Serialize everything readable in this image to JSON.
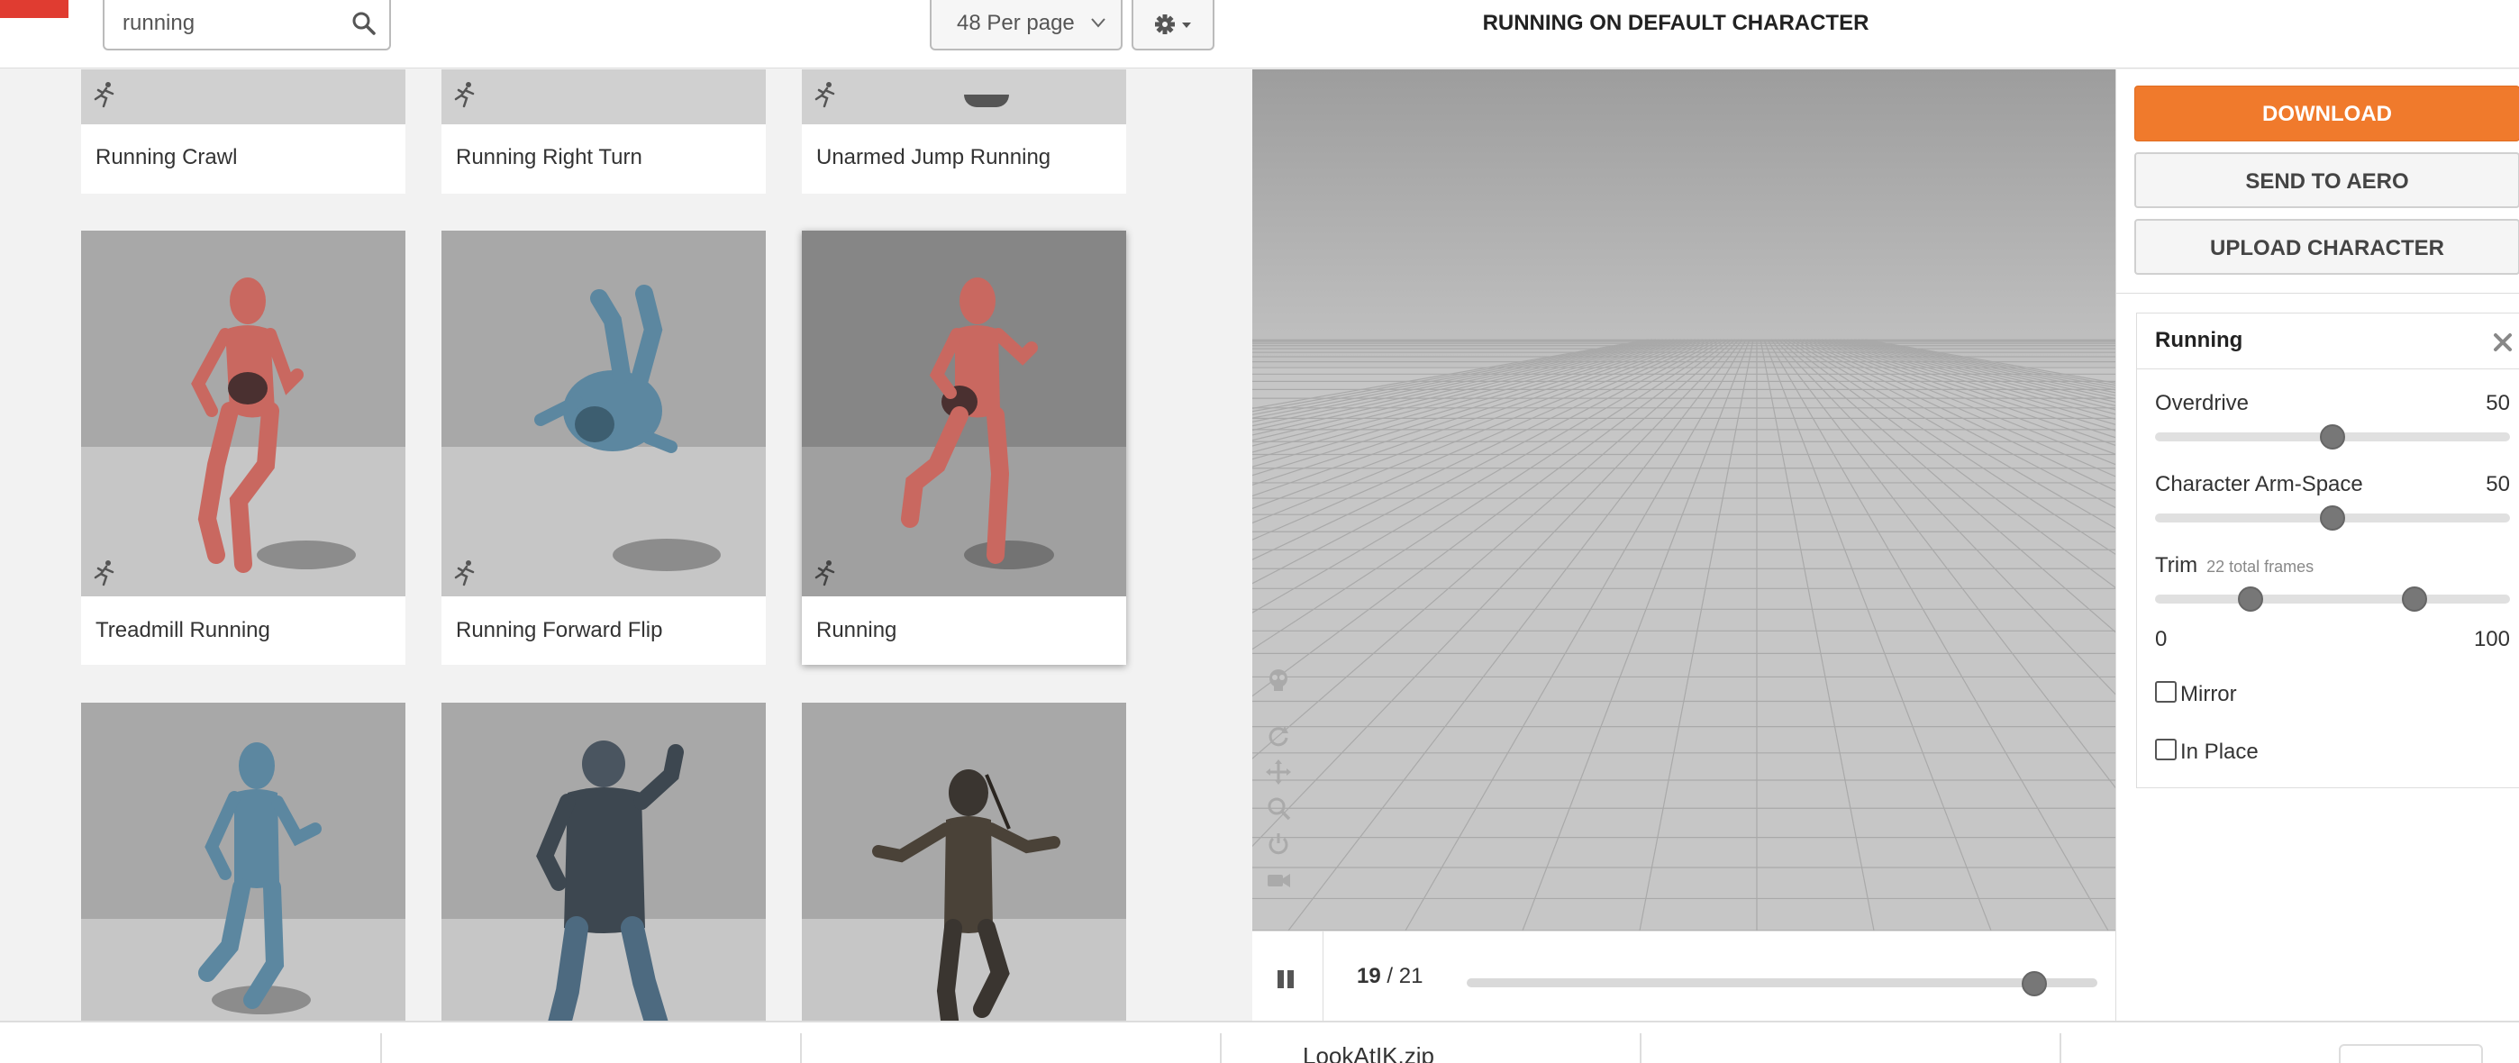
{
  "search": {
    "value": "running",
    "placeholder": "Search"
  },
  "per_page": {
    "selected": "48 Per page"
  },
  "grid": {
    "row1": [
      {
        "label": "Running Crawl"
      },
      {
        "label": "Running Right Turn"
      },
      {
        "label": "Unarmed Jump Running"
      }
    ],
    "row2": [
      {
        "label": "Treadmill Running"
      },
      {
        "label": "Running Forward Flip"
      },
      {
        "label": "Running",
        "selected": true
      }
    ],
    "row3": [
      {
        "label": ""
      },
      {
        "label": ""
      },
      {
        "label": ""
      }
    ]
  },
  "preview": {
    "title": "RUNNING ON DEFAULT CHARACTER"
  },
  "playback": {
    "current_frame": "19",
    "total_frames": "21",
    "progress_fraction": 0.9
  },
  "actions": {
    "download": "DOWNLOAD",
    "send_to_aero": "SEND TO AERO",
    "upload_character": "UPLOAD CHARACTER"
  },
  "animation_panel": {
    "title": "Running",
    "overdrive": {
      "label": "Overdrive",
      "value": "50",
      "fraction": 0.5
    },
    "arm_space": {
      "label": "Character Arm-Space",
      "value": "50",
      "fraction": 0.5
    },
    "trim": {
      "label": "Trim",
      "note": "22 total frames",
      "min": "0",
      "max": "100",
      "start_fraction": 0.27,
      "end_fraction": 0.73
    },
    "mirror": {
      "label": "Mirror",
      "checked": false
    },
    "in_place": {
      "label": "In Place",
      "checked": false
    }
  },
  "downloads_bar": {
    "file": "LookAtIK.zip"
  },
  "colors": {
    "accent": "#f07a2c",
    "brand_red": "#e03c31",
    "mannequin_red": "#c96860",
    "mannequin_blue": "#5c87a0"
  }
}
